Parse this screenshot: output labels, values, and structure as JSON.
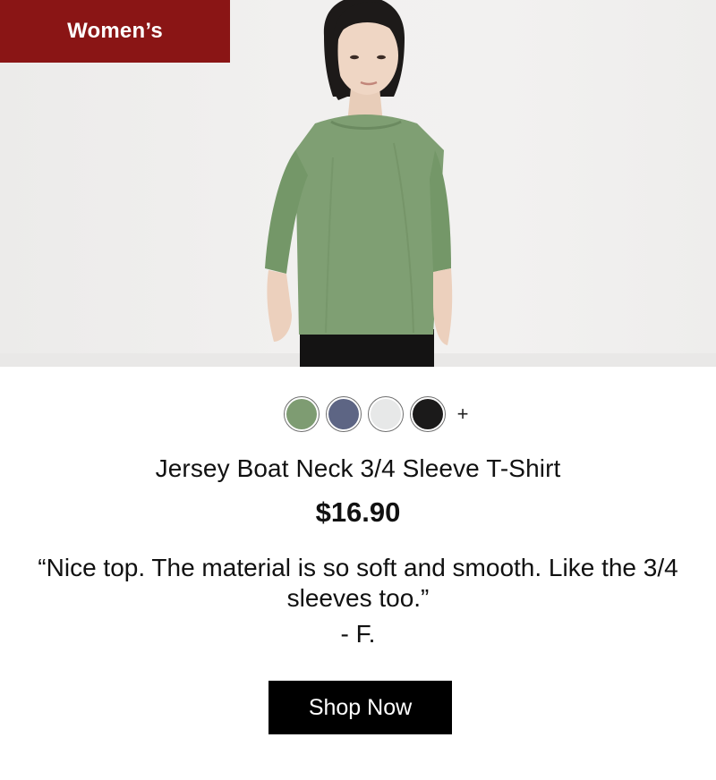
{
  "category": {
    "label": "Women’s"
  },
  "product": {
    "title": "Jersey Boat Neck 3/4 Sleeve T-Shirt",
    "price": "$16.90",
    "image_description_icon": "product-photo",
    "swatches": [
      {
        "name": "green",
        "color": "#7e9c72"
      },
      {
        "name": "navy",
        "color": "#5d6584"
      },
      {
        "name": "white",
        "color": "#e7e8e8"
      },
      {
        "name": "black",
        "color": "#1b1a1a"
      }
    ],
    "more_colors_label": "+"
  },
  "review": {
    "quote": "“Nice top. The material is so soft and smooth. Like the 3/4 sleeves too.”",
    "author": "- F."
  },
  "cta": {
    "label": "Shop Now"
  },
  "colors": {
    "badge": "#8a1515",
    "button": "#000000",
    "shirt": "#7f9f73"
  }
}
